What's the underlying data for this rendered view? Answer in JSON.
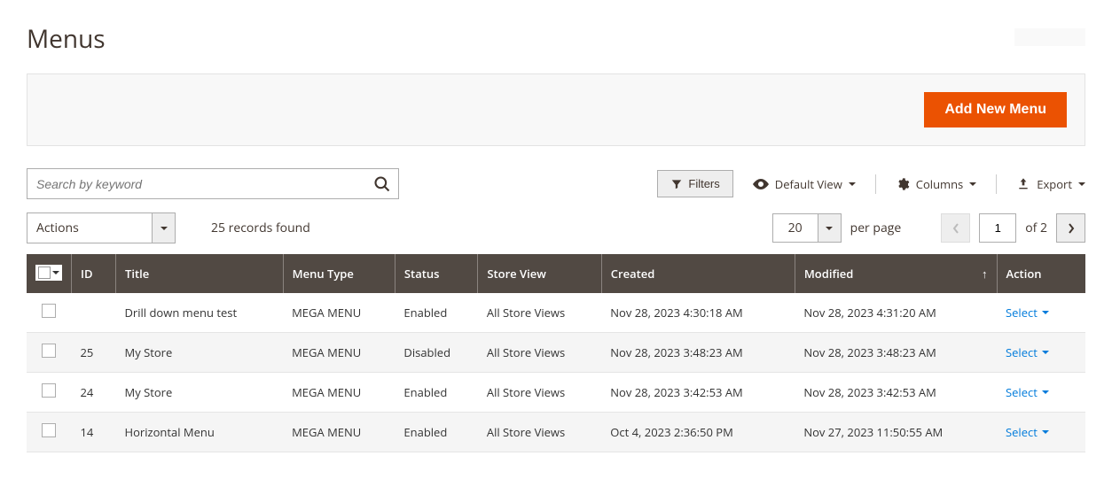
{
  "header": {
    "title": "Menus",
    "add_button": "Add New Menu"
  },
  "search": {
    "placeholder": "Search by keyword"
  },
  "controls": {
    "filters": "Filters",
    "default_view": "Default View",
    "columns": "Columns",
    "export": "Export"
  },
  "grid_toolbar": {
    "actions_label": "Actions",
    "records_found": "25 records found",
    "per_page_value": "20",
    "per_page_label": "per page",
    "current_page": "1",
    "of_pages": "of 2"
  },
  "table": {
    "columns": {
      "id": "ID",
      "title": "Title",
      "menu_type": "Menu Type",
      "status": "Status",
      "store_view": "Store View",
      "created": "Created",
      "modified": "Modified",
      "action": "Action"
    },
    "action_label": "Select",
    "rows": [
      {
        "id": "",
        "title": "Drill down menu test",
        "menu_type": "MEGA MENU",
        "status": "Enabled",
        "store_view": "All Store Views",
        "created": "Nov 28, 2023 4:30:18 AM",
        "modified": "Nov 28, 2023 4:31:20 AM"
      },
      {
        "id": "25",
        "title": "My Store",
        "menu_type": "MEGA MENU",
        "status": "Disabled",
        "store_view": "All Store Views",
        "created": "Nov 28, 2023 3:48:23 AM",
        "modified": "Nov 28, 2023 3:48:23 AM"
      },
      {
        "id": "24",
        "title": "My Store",
        "menu_type": "MEGA MENU",
        "status": "Enabled",
        "store_view": "All Store Views",
        "created": "Nov 28, 2023 3:42:53 AM",
        "modified": "Nov 28, 2023 3:42:53 AM"
      },
      {
        "id": "14",
        "title": "Horizontal Menu",
        "menu_type": "MEGA MENU",
        "status": "Enabled",
        "store_view": "All Store Views",
        "created": "Oct 4, 2023 2:36:50 PM",
        "modified": "Nov 27, 2023 11:50:55 AM"
      }
    ]
  }
}
